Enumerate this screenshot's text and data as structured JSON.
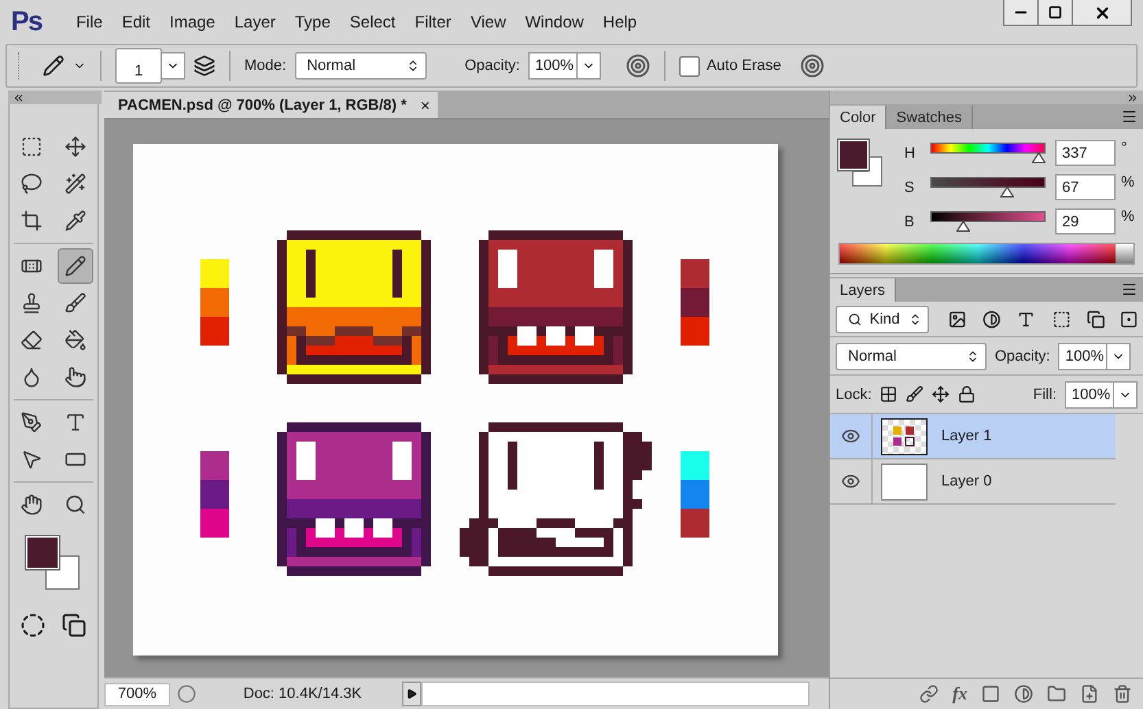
{
  "app": {
    "logo": "Ps"
  },
  "menu": [
    "File",
    "Edit",
    "Image",
    "Layer",
    "Type",
    "Select",
    "Filter",
    "View",
    "Window",
    "Help"
  ],
  "options_bar": {
    "brush_size": "1",
    "mode_label": "Mode:",
    "mode": "Normal",
    "opacity_label": "Opacity:",
    "opacity": "100%",
    "auto_erase": {
      "label": "Auto Erase",
      "checked": false
    }
  },
  "tools": [
    {
      "selected": false
    },
    {
      "selected": false
    },
    {
      "selected": false
    },
    {
      "selected": false
    },
    {
      "selected": false
    },
    {
      "selected": false
    },
    {
      "selected": false
    },
    {
      "selected": true
    },
    {
      "selected": false
    },
    {
      "selected": false
    },
    {
      "selected": false
    },
    {
      "selected": false
    },
    {
      "selected": false
    },
    {
      "selected": false
    },
    {
      "selected": false
    },
    {
      "selected": false
    },
    {
      "selected": false
    },
    {
      "selected": false
    },
    {
      "selected": false
    },
    {
      "selected": false
    }
  ],
  "document": {
    "tab_title": "PACMEN.psd @ 700% (Layer 1, RGB/8) *",
    "close": "×"
  },
  "status_bar": {
    "zoom": "700%",
    "doc_info": "Doc: 10.4K/14.3K"
  },
  "color_panel": {
    "tabs": [
      {
        "label": "Color",
        "selected": true
      },
      {
        "label": "Swatches",
        "selected": false
      }
    ],
    "sliders": [
      {
        "label": "H",
        "value": "337",
        "unit": "°",
        "level": 0.94
      },
      {
        "label": "S",
        "value": "67",
        "unit": "%",
        "level": 0.67
      },
      {
        "label": "B",
        "value": "29",
        "unit": "%",
        "level": 0.29
      }
    ]
  },
  "layers_panel": {
    "tab": "Layers",
    "filter": "Kind",
    "blend_mode": "Normal",
    "opacity_label": "Opacity:",
    "opacity": "100%",
    "lock_label": "Lock:",
    "fill_label": "Fill:",
    "fill": "100%",
    "layers": [
      {
        "name": "Layer 1",
        "selected": true,
        "visible": true,
        "kind": "art"
      },
      {
        "name": "Layer 0",
        "selected": false,
        "visible": true,
        "kind": "blank"
      }
    ],
    "footer_fx": "fx"
  }
}
